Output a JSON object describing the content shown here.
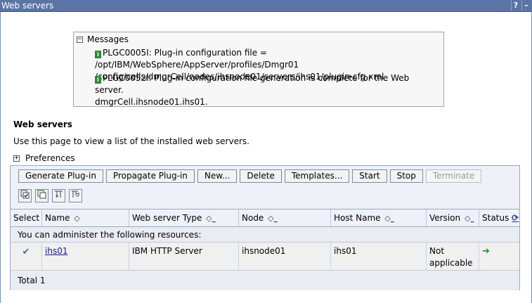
{
  "window": {
    "title": "Web servers",
    "help_label": "?",
    "minimize_label": "–"
  },
  "messages": {
    "header": "Messages",
    "items": [
      {
        "line1": "PLGC0005I: Plug-in configuration file = /opt/IBM/WebSphere/AppServer/profiles/Dmgr01",
        "line2": "/config/cells/dmgrCell/nodes/ihsnode01/servers/ihs01/plugin-cfg.xml"
      },
      {
        "line1": "PLGC0052I: Plug-in configuration file generation is complete for the Web server.",
        "line2": "dmgrCell.ihsnode01.ihs01."
      }
    ]
  },
  "section": {
    "title": "Web servers",
    "description": "Use this page to view a list of the installed web servers.",
    "preferences_label": "Preferences"
  },
  "toolbar": {
    "buttons": [
      {
        "label": "Generate Plug-in",
        "enabled": true
      },
      {
        "label": "Propagate Plug-in",
        "enabled": true
      },
      {
        "label": "New...",
        "enabled": true
      },
      {
        "label": "Delete",
        "enabled": true
      },
      {
        "label": "Templates...",
        "enabled": true
      },
      {
        "label": "Start",
        "enabled": true
      },
      {
        "label": "Stop",
        "enabled": true
      },
      {
        "label": "Terminate",
        "enabled": false
      }
    ],
    "icons": [
      "select-all-icon",
      "deselect-all-icon",
      "show-filter-icon",
      "clear-filter-icon"
    ]
  },
  "table": {
    "columns": [
      "Select",
      "Name",
      "Web server Type",
      "Node",
      "Host Name",
      "Version",
      "Status"
    ],
    "admin_message": "You can administer the following resources:",
    "rows": [
      {
        "name": "ihs01",
        "type": "IBM HTTP Server",
        "node": "ihsnode01",
        "host": "ihs01",
        "version_line1": "Not",
        "version_line2": "applicable",
        "status_icon": "started-arrow-icon"
      }
    ],
    "total": "Total 1"
  },
  "colors": {
    "titlebar": "#5a74a6",
    "panel": "#eef1f7",
    "status_started": "#1e8e2e"
  }
}
